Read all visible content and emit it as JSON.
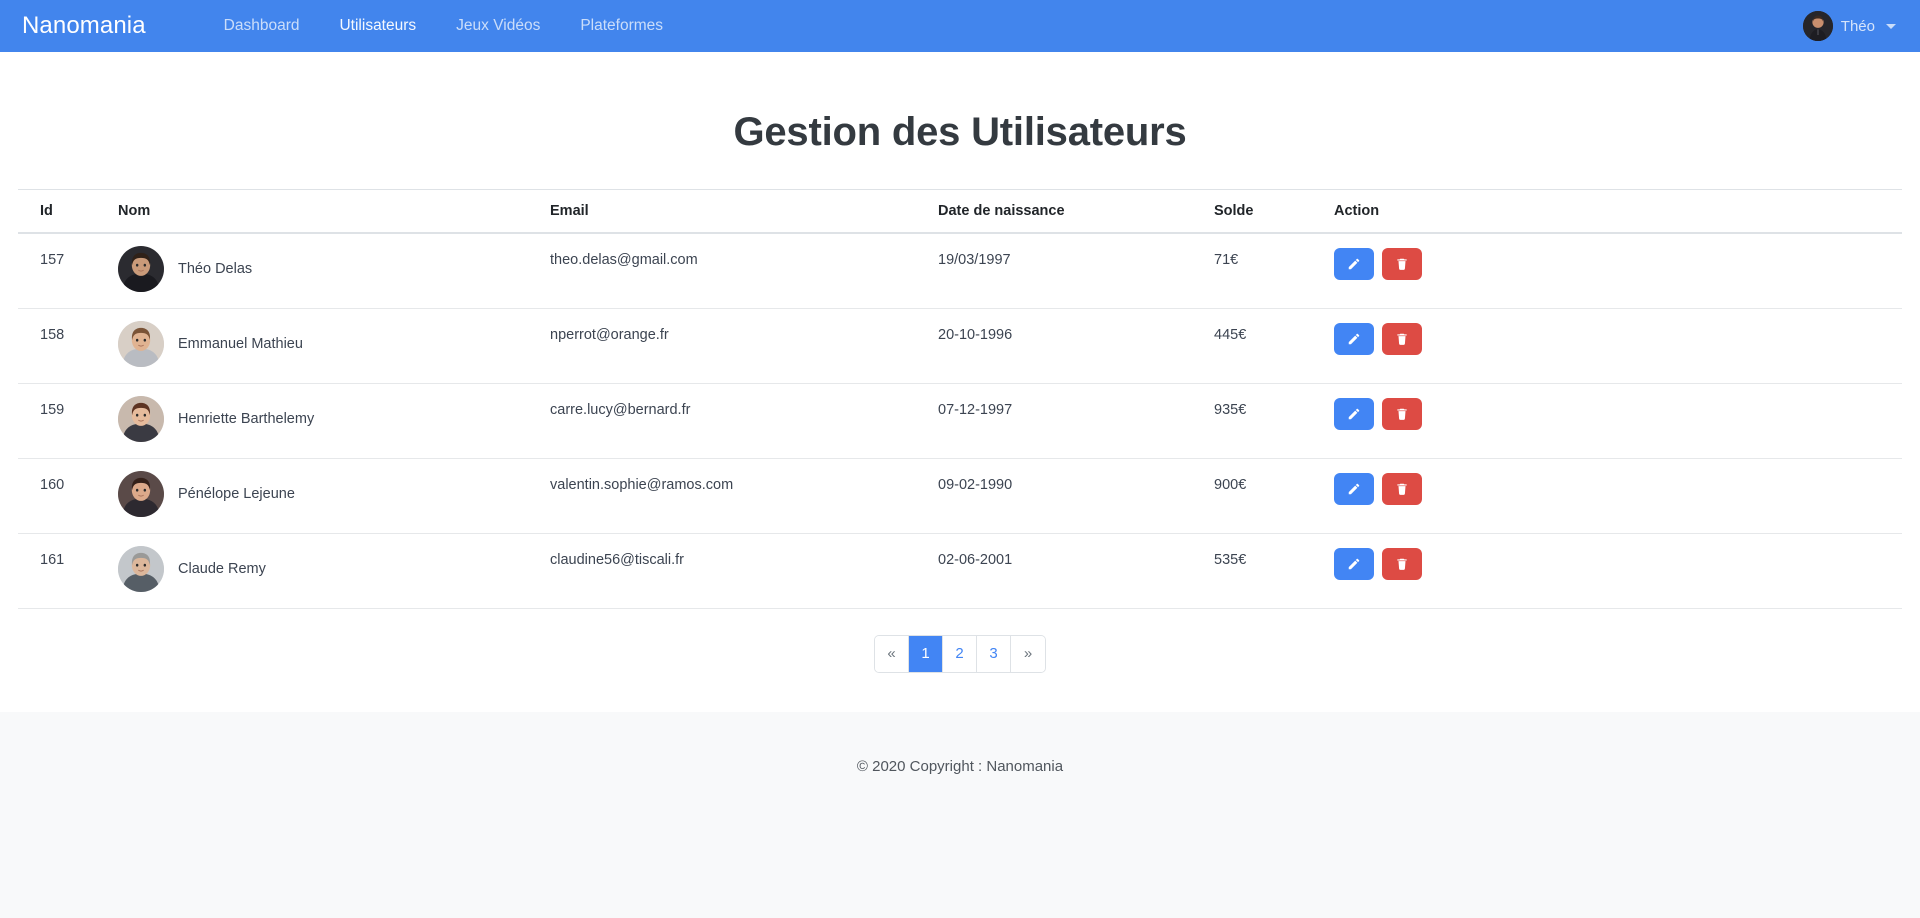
{
  "navbar": {
    "brand": "Nanomania",
    "links": [
      {
        "label": "Dashboard",
        "active": false
      },
      {
        "label": "Utilisateurs",
        "active": true
      },
      {
        "label": "Jeux Vidéos",
        "active": false
      },
      {
        "label": "Plateformes",
        "active": false
      }
    ],
    "user": {
      "name": "Théo",
      "avatar_icon": "user-photo-avatar",
      "caret_icon": "chevron-down-icon"
    },
    "background_color": "#4285ed"
  },
  "page": {
    "title": "Gestion des Utilisateurs"
  },
  "table": {
    "headers": [
      "Id",
      "Nom",
      "Email",
      "Date de naissance",
      "Solde",
      "Action"
    ],
    "rows": [
      {
        "id": "157",
        "nom": "Théo Delas",
        "email": "theo.delas@gmail.com",
        "date": "19/03/1997",
        "solde": "71€",
        "avatar_icon": "user-photo-avatar"
      },
      {
        "id": "158",
        "nom": "Emmanuel Mathieu",
        "email": "nperrot@orange.fr",
        "date": "20-10-1996",
        "solde": "445€",
        "avatar_icon": "user-photo-avatar"
      },
      {
        "id": "159",
        "nom": "Henriette Barthelemy",
        "email": "carre.lucy@bernard.fr",
        "date": "07-12-1997",
        "solde": "935€",
        "avatar_icon": "user-photo-avatar"
      },
      {
        "id": "160",
        "nom": "Pénélope Lejeune",
        "email": "valentin.sophie@ramos.com",
        "date": "09-02-1990",
        "solde": "900€",
        "avatar_icon": "user-photo-avatar"
      },
      {
        "id": "161",
        "nom": "Claude Remy",
        "email": "claudine56@tiscali.fr",
        "date": "02-06-2001",
        "solde": "535€",
        "avatar_icon": "user-photo-avatar"
      }
    ],
    "actions": {
      "edit_icon": "pencil-icon",
      "delete_icon": "trash-icon",
      "edit_color": "#4285f4",
      "delete_color": "#dd4b44"
    }
  },
  "pagination": {
    "prev_label": "«",
    "next_label": "»",
    "pages": [
      "1",
      "2",
      "3"
    ],
    "current": "1",
    "active_color": "#4285f4"
  },
  "footer": {
    "text": "© 2020 Copyright : Nanomania",
    "background_color": "#f8f9fa"
  }
}
